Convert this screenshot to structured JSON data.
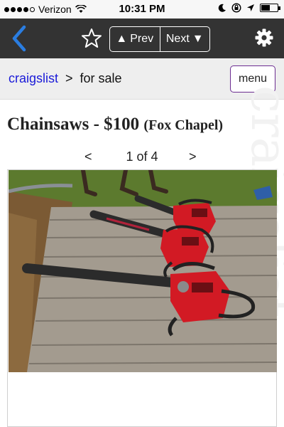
{
  "status_bar": {
    "carrier": "Verizon",
    "time": "10:31 PM",
    "icons": [
      "signal-dots-icon",
      "wifi-icon",
      "moon-icon",
      "rotation-lock-icon",
      "location-arrow-icon",
      "battery-icon"
    ]
  },
  "nav": {
    "prev_label": "Prev",
    "next_label": "Next",
    "icons": [
      "back-chevron-icon",
      "star-icon",
      "gear-icon"
    ]
  },
  "breadcrumb": {
    "site": "craigslist",
    "separator": ">",
    "section": "for sale",
    "menu_label": "menu"
  },
  "posting": {
    "title": "Chainsaws - $100",
    "location": "(Fox Chapel)"
  },
  "gallery": {
    "prev_symbol": "<",
    "counter": "1 of 4",
    "next_symbol": ">"
  },
  "colors": {
    "nav_bg": "#333333",
    "link": "#1a1ad8",
    "back_arrow": "#2a7de1",
    "chainsaw_red": "#d21a24",
    "menu_border": "#6b2c91"
  }
}
